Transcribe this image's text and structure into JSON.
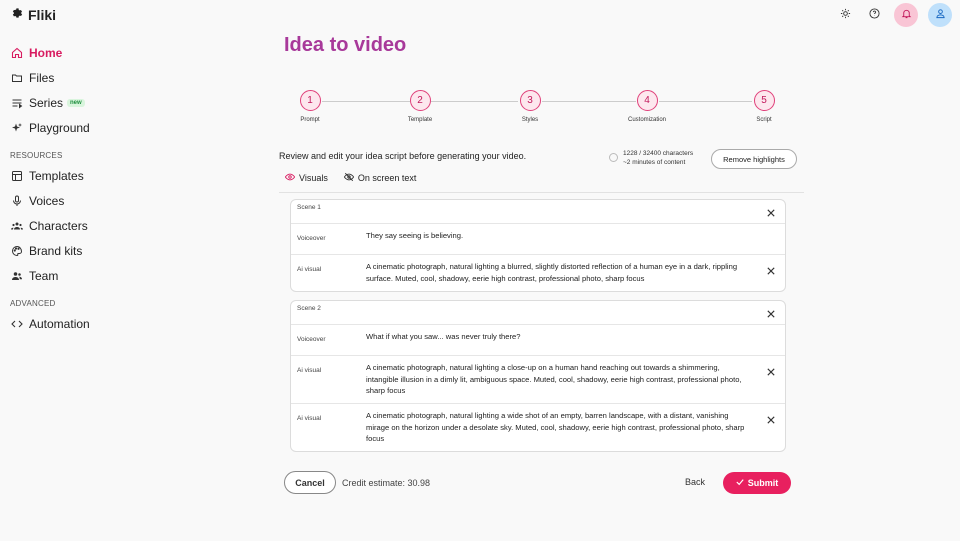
{
  "app": {
    "name": "Fliki"
  },
  "sidebar": {
    "items": [
      {
        "label": "Home",
        "icon": "home-icon"
      },
      {
        "label": "Files",
        "icon": "folder-icon"
      },
      {
        "label": "Series",
        "icon": "list-icon",
        "badge": "new"
      },
      {
        "label": "Playground",
        "icon": "sparkles-icon"
      }
    ],
    "resources_title": "RESOURCES",
    "resources": [
      {
        "label": "Templates",
        "icon": "template-icon"
      },
      {
        "label": "Voices",
        "icon": "mic-icon"
      },
      {
        "label": "Characters",
        "icon": "people-icon"
      },
      {
        "label": "Brand kits",
        "icon": "palette-icon"
      },
      {
        "label": "Team",
        "icon": "team-icon"
      }
    ],
    "advanced_title": "ADVANCED",
    "advanced": [
      {
        "label": "Automation",
        "icon": "code-icon"
      }
    ]
  },
  "page": {
    "title": "Idea to video"
  },
  "steps": [
    {
      "number": "1",
      "label": "Prompt"
    },
    {
      "number": "2",
      "label": "Template"
    },
    {
      "number": "3",
      "label": "Styles"
    },
    {
      "number": "4",
      "label": "Customization"
    },
    {
      "number": "5",
      "label": "Script"
    }
  ],
  "review": {
    "text": "Review and edit your idea script before generating your video.",
    "characters": "1228 / 32400 characters",
    "duration": "~2 minutes of content",
    "remove_highlights": "Remove highlights"
  },
  "tabs": [
    {
      "label": "Visuals",
      "icon": "eye-icon"
    },
    {
      "label": "On screen text",
      "icon": "eye-off-icon"
    }
  ],
  "scenes": [
    {
      "title": "Scene 1",
      "rows": [
        {
          "label": "Voiceover",
          "text": "They say seeing is believing."
        },
        {
          "label": "Ai visual",
          "text": "A cinematic photograph, natural lighting a blurred, slightly distorted reflection of a human eye in a dark, rippling surface. Muted, cool, shadowy, eerie high contrast, professional photo, sharp focus"
        }
      ]
    },
    {
      "title": "Scene 2",
      "rows": [
        {
          "label": "Voiceover",
          "text": "What if what you saw... was never truly there?"
        },
        {
          "label": "Ai visual",
          "text": "A cinematic photograph, natural lighting a close-up on a human hand reaching out towards a shimmering, intangible illusion in a dimly lit, ambiguous space. Muted, cool, shadowy, eerie high contrast, professional photo, sharp focus"
        },
        {
          "label": "Ai visual",
          "text": "A cinematic photograph, natural lighting a wide shot of an empty, barren landscape, with a distant, vanishing mirage on the horizon under a desolate sky. Muted, cool, shadowy, eerie high contrast, professional photo, sharp focus"
        }
      ]
    }
  ],
  "footer": {
    "cancel": "Cancel",
    "credit": "Credit estimate: 30.98",
    "back": "Back",
    "submit": "Submit"
  },
  "colors": {
    "accent": "#e8205f",
    "title": "#a8399a",
    "step_fill": "#fde7ee"
  }
}
